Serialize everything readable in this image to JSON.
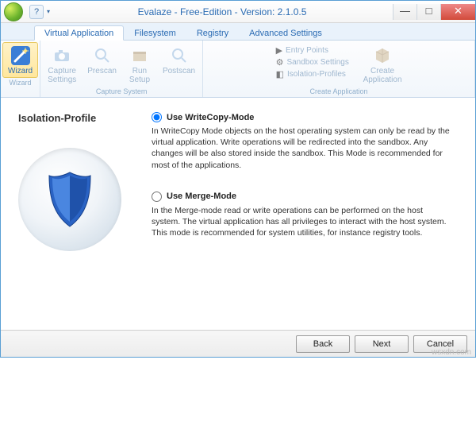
{
  "title": "Evalaze - Free-Edition - Version: 2.1.0.5",
  "tabs": {
    "virtual_app": "Virtual Application",
    "filesystem": "Filesystem",
    "registry": "Registry",
    "advanced": "Advanced Settings"
  },
  "ribbon": {
    "wizard": {
      "label": "Wizard",
      "group": "Wizard"
    },
    "capture_settings": "Capture\nSettings",
    "prescan": "Prescan",
    "run_setup": "Run\nSetup",
    "postscan": "Postscan",
    "capture_group": "Capture System",
    "entry_points": "Entry Points",
    "sandbox_settings": "Sandbox Settings",
    "isolation_profiles": "Isolation-Profiles",
    "create_application": "Create\nApplication",
    "create_group": "Create Application"
  },
  "page": {
    "heading": "Isolation-Profile",
    "opt1_label": "Use WriteCopy-Mode",
    "opt1_desc": "In WriteCopy Mode objects on the host operating system can only be read by the virtual application. Write operations will be redirected into the sandbox. Any changes will be also stored inside the sandbox. This Mode is recommended for most of the applications.",
    "opt2_label": "Use Merge-Mode",
    "opt2_desc": "In the Merge-mode read or write operations can be performed on the host system. The virtual application has all privileges to interact with the host system. This mode is recommended for system utilities, for instance registry tools."
  },
  "footer": {
    "back": "Back",
    "next": "Next",
    "cancel": "Cancel"
  },
  "watermark": "wsxdn.com"
}
